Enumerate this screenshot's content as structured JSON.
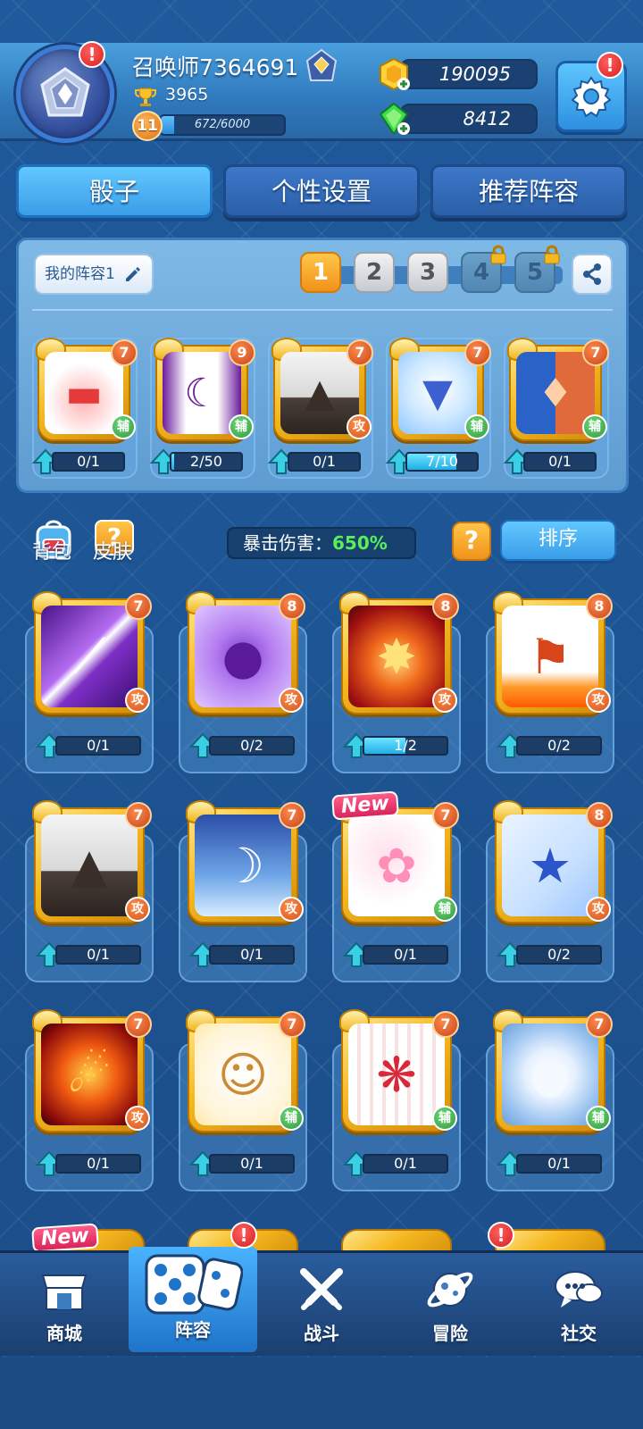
{
  "player": {
    "name": "召唤师7364691",
    "trophies": "3965",
    "level": "11",
    "xp_text": "672/6000",
    "xp_fraction": 0.112
  },
  "currency": {
    "gold": "190095",
    "gems": "8412"
  },
  "alerts": {
    "mark": "!"
  },
  "tabs": [
    {
      "label": "骰子"
    },
    {
      "label": "个性设置"
    },
    {
      "label": "推荐阵容"
    }
  ],
  "deck": {
    "name_label": "我的阵容1",
    "slots": [
      "1",
      "2",
      "3",
      "4",
      "5"
    ],
    "active_slot": "1",
    "locked_slots": [
      "4",
      "5"
    ],
    "dice": [
      {
        "name": "red-hat",
        "level": "7",
        "type": "辅",
        "progress": "0/1",
        "fill": 0
      },
      {
        "name": "mask",
        "level": "9",
        "type": "辅",
        "progress": "2/50",
        "fill": 0.04
      },
      {
        "name": "volcano",
        "level": "7",
        "type": "攻",
        "progress": "0/1",
        "fill": 0
      },
      {
        "name": "magic-hat",
        "level": "7",
        "type": "辅",
        "progress": "7/10",
        "fill": 0.7
      },
      {
        "name": "twin-figures",
        "level": "7",
        "type": "辅",
        "progress": "0/1",
        "fill": 0
      }
    ]
  },
  "toolbar": {
    "bag_label": "背包",
    "skin_label": "皮肤",
    "skin_icon_text": "?",
    "crit_label": "暴击伤害：",
    "crit_value": "650%",
    "help_text": "?",
    "sort_label": "排序"
  },
  "collection": [
    {
      "name": "purple-slash",
      "level": "7",
      "type": "攻",
      "progress": "0/1",
      "fill": 0
    },
    {
      "name": "purple-ghost",
      "level": "8",
      "type": "攻",
      "progress": "0/2",
      "fill": 0
    },
    {
      "name": "fire-claw",
      "level": "8",
      "type": "攻",
      "progress": "1/2",
      "fill": 0.5
    },
    {
      "name": "war-banner",
      "level": "8",
      "type": "攻",
      "progress": "0/2",
      "fill": 0
    },
    {
      "name": "volcano",
      "level": "7",
      "type": "攻",
      "progress": "0/1",
      "fill": 0
    },
    {
      "name": "moon-lady",
      "level": "7",
      "type": "攻",
      "progress": "0/1",
      "fill": 0
    },
    {
      "name": "cherry-blossom",
      "level": "7",
      "type": "辅",
      "progress": "0/1",
      "fill": 0,
      "is_new": true
    },
    {
      "name": "shooting-stars",
      "level": "8",
      "type": "攻",
      "progress": "0/2",
      "fill": 0
    },
    {
      "name": "fire-dragon",
      "level": "7",
      "type": "攻",
      "progress": "0/1",
      "fill": 0
    },
    {
      "name": "lucky-cat",
      "level": "7",
      "type": "辅",
      "progress": "0/1",
      "fill": 0
    },
    {
      "name": "paw-print",
      "level": "7",
      "type": "辅",
      "progress": "0/1",
      "fill": 0
    },
    {
      "name": "full-moon",
      "level": "7",
      "type": "辅",
      "progress": "0/1",
      "fill": 0
    }
  ],
  "new_tag": "New",
  "nav": [
    {
      "label": "商城",
      "icon": "shop-icon"
    },
    {
      "label": "阵容",
      "icon": "dice-icon"
    },
    {
      "label": "战斗",
      "icon": "crossed-swords-icon"
    },
    {
      "label": "冒险",
      "icon": "planet-icon"
    },
    {
      "label": "社交",
      "icon": "chat-bubbles-icon"
    }
  ],
  "colors": {
    "background": "#1d5290",
    "accent_blue": "#3a9de8",
    "gold": "#f5b820",
    "attack_badge": "#d4541c",
    "support_badge": "#2f9a3d",
    "crit_value": "#57f05a"
  }
}
